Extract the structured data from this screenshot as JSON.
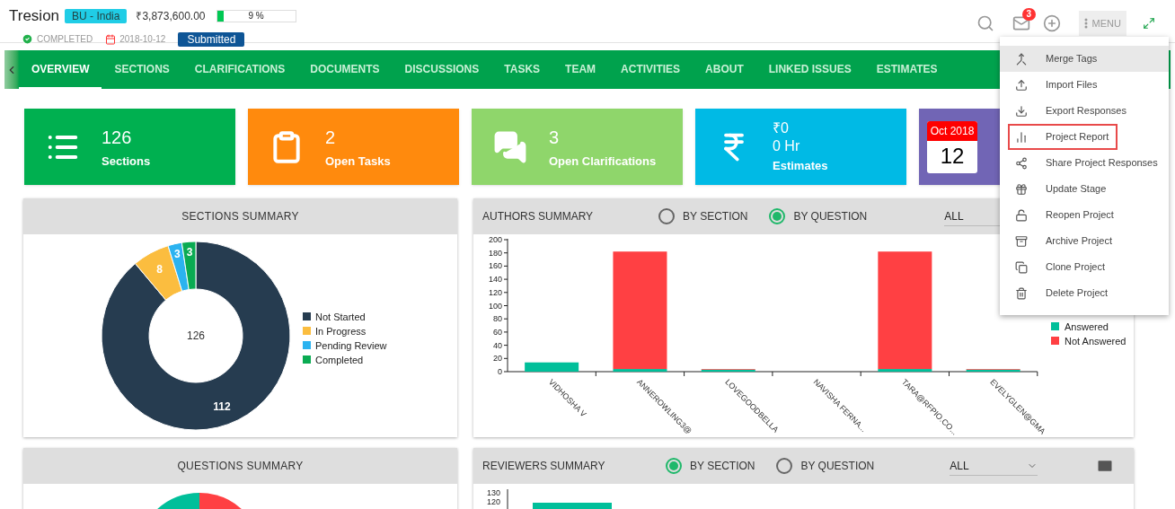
{
  "header": {
    "title": "Tresion",
    "business_unit": "BU - India",
    "amount": "₹3,873,600.00",
    "progress": {
      "level": 0.09,
      "label": "9 %"
    },
    "status": "COMPLETED",
    "date": "2018-10-12",
    "stage": "Submitted",
    "notifications": "3",
    "menu_label": "MENU"
  },
  "tabs": [
    {
      "label": "OVERVIEW",
      "selected": true
    },
    {
      "label": "SECTIONS",
      "selected": false
    },
    {
      "label": "CLARIFICATIONS",
      "selected": false
    },
    {
      "label": "DOCUMENTS",
      "selected": false
    },
    {
      "label": "DISCUSSIONS",
      "selected": false
    },
    {
      "label": "TASKS",
      "selected": false
    },
    {
      "label": "TEAM",
      "selected": false
    },
    {
      "label": "ACTIVITIES",
      "selected": false
    },
    {
      "label": "ABOUT",
      "selected": false
    },
    {
      "label": "LINKED ISSUES",
      "selected": false
    },
    {
      "label": "ESTIMATES",
      "selected": false
    }
  ],
  "cards": [
    {
      "kind": "list",
      "color": "#00b050",
      "value": "126",
      "label": "Sections"
    },
    {
      "kind": "clipboard",
      "color": "#ff8a0d",
      "value": "2",
      "label": "Open Tasks"
    },
    {
      "kind": "chat",
      "color": "#8fd66b",
      "value": "3",
      "label": "Open Clarifications"
    },
    {
      "kind": "currency",
      "color": "#00bae5",
      "value": "₹0",
      "hours": "0 Hr",
      "label": "Estimates"
    },
    {
      "kind": "calendar",
      "color": "#7165b5",
      "month": "Oct 2018",
      "day": "12"
    }
  ],
  "sections_summary": {
    "title": "SECTIONS SUMMARY",
    "center_label": "126",
    "chart_data": {
      "type": "donut",
      "categories": [
        "Not Started",
        "In Progress",
        "Pending Review",
        "Completed"
      ],
      "values": [
        112,
        8,
        3,
        3
      ],
      "colors": [
        "#263c50",
        "#fbbd3f",
        "#2bb3f0",
        "#0aab52"
      ],
      "data_labels": true,
      "legend": "right"
    }
  },
  "authors_summary": {
    "title": "AUTHORS SUMMARY",
    "options": [
      {
        "label": "BY SECTION",
        "selected": false
      },
      {
        "label": "BY QUESTION",
        "selected": true
      }
    ],
    "filter": "ALL",
    "chart_data": {
      "type": "bar",
      "stacked": true,
      "categories": [
        "VIDHOSHA V",
        "ANNEROWLING3@",
        "LOVEGOODBELLA",
        "NAVISHA FERNA...",
        "TARA@RFPIO.CO...",
        "EVELYGLEN@GMA"
      ],
      "series": [
        {
          "name": "Answered",
          "color": "#00bf9a",
          "values": [
            14,
            4,
            3,
            0,
            4,
            3
          ]
        },
        {
          "name": "Not Answered",
          "color": "#ff4043",
          "values": [
            0,
            178,
            1,
            0,
            178,
            1
          ]
        }
      ],
      "ylim": [
        0,
        200
      ],
      "legend": "right",
      "yticks": [
        0,
        20,
        40,
        60,
        80,
        100,
        120,
        140,
        160,
        180,
        200
      ]
    }
  },
  "menu": {
    "items": [
      {
        "label": "Merge Tags",
        "highlighted": true,
        "outlined": false
      },
      {
        "label": "Import Files",
        "highlighted": false,
        "outlined": false
      },
      {
        "label": "Export Responses",
        "highlighted": false,
        "outlined": false
      },
      {
        "label": "Project Report",
        "highlighted": false,
        "outlined": true
      },
      {
        "label": "Share Project Responses",
        "highlighted": false,
        "outlined": false
      },
      {
        "label": "Update Stage",
        "highlighted": false,
        "outlined": false
      },
      {
        "label": "Reopen Project",
        "highlighted": false,
        "outlined": false
      },
      {
        "label": "Archive Project",
        "highlighted": false,
        "outlined": false
      },
      {
        "label": "Clone Project",
        "highlighted": false,
        "outlined": false
      },
      {
        "label": "Delete Project",
        "highlighted": false,
        "outlined": false
      }
    ]
  },
  "questions_summary": {
    "title": "QUESTIONS SUMMARY"
  },
  "reviewers_summary": {
    "title": "REVIEWERS SUMMARY",
    "options": [
      {
        "label": "BY SECTION",
        "selected": true
      },
      {
        "label": "BY QUESTION",
        "selected": false
      }
    ],
    "filter": "ALL",
    "axis_labels": [
      "130",
      "120"
    ]
  }
}
